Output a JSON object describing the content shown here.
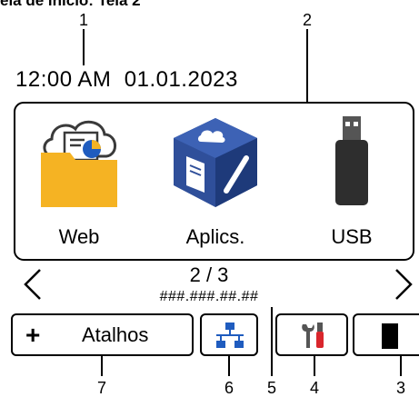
{
  "document": {
    "title": "ela de início: Tela 2"
  },
  "callouts": [
    "1",
    "2",
    "7",
    "6",
    "5",
    "4",
    "3"
  ],
  "status": {
    "time": "12:00 AM",
    "date": "01.01.2023"
  },
  "apps": [
    {
      "label": "Web",
      "icon": "web-icon"
    },
    {
      "label": "Aplics.",
      "icon": "apps-icon"
    },
    {
      "label": "USB",
      "icon": "usb-icon"
    }
  ],
  "pager": {
    "current": "2 / 3",
    "prev_icon": "chevron-left-icon",
    "next_icon": "chevron-right-icon"
  },
  "network": {
    "ip": "###.###.##.##"
  },
  "bottom_bar": {
    "shortcuts_label": "Atalhos",
    "shortcuts_icon": "plus-icon",
    "network_icon": "network-icon",
    "tools_icon": "tools-icon",
    "toner_icon": "toner-icon"
  },
  "colors": {
    "folder": "#f5b323",
    "cloud_outline": "#3a3a3a",
    "cube_blue": "#2f4f9a",
    "cube_dark": "#1e3a7a",
    "usb_body": "#2e2e2e",
    "network_blue": "#1f5cbf",
    "tools_red": "#d9262c"
  }
}
